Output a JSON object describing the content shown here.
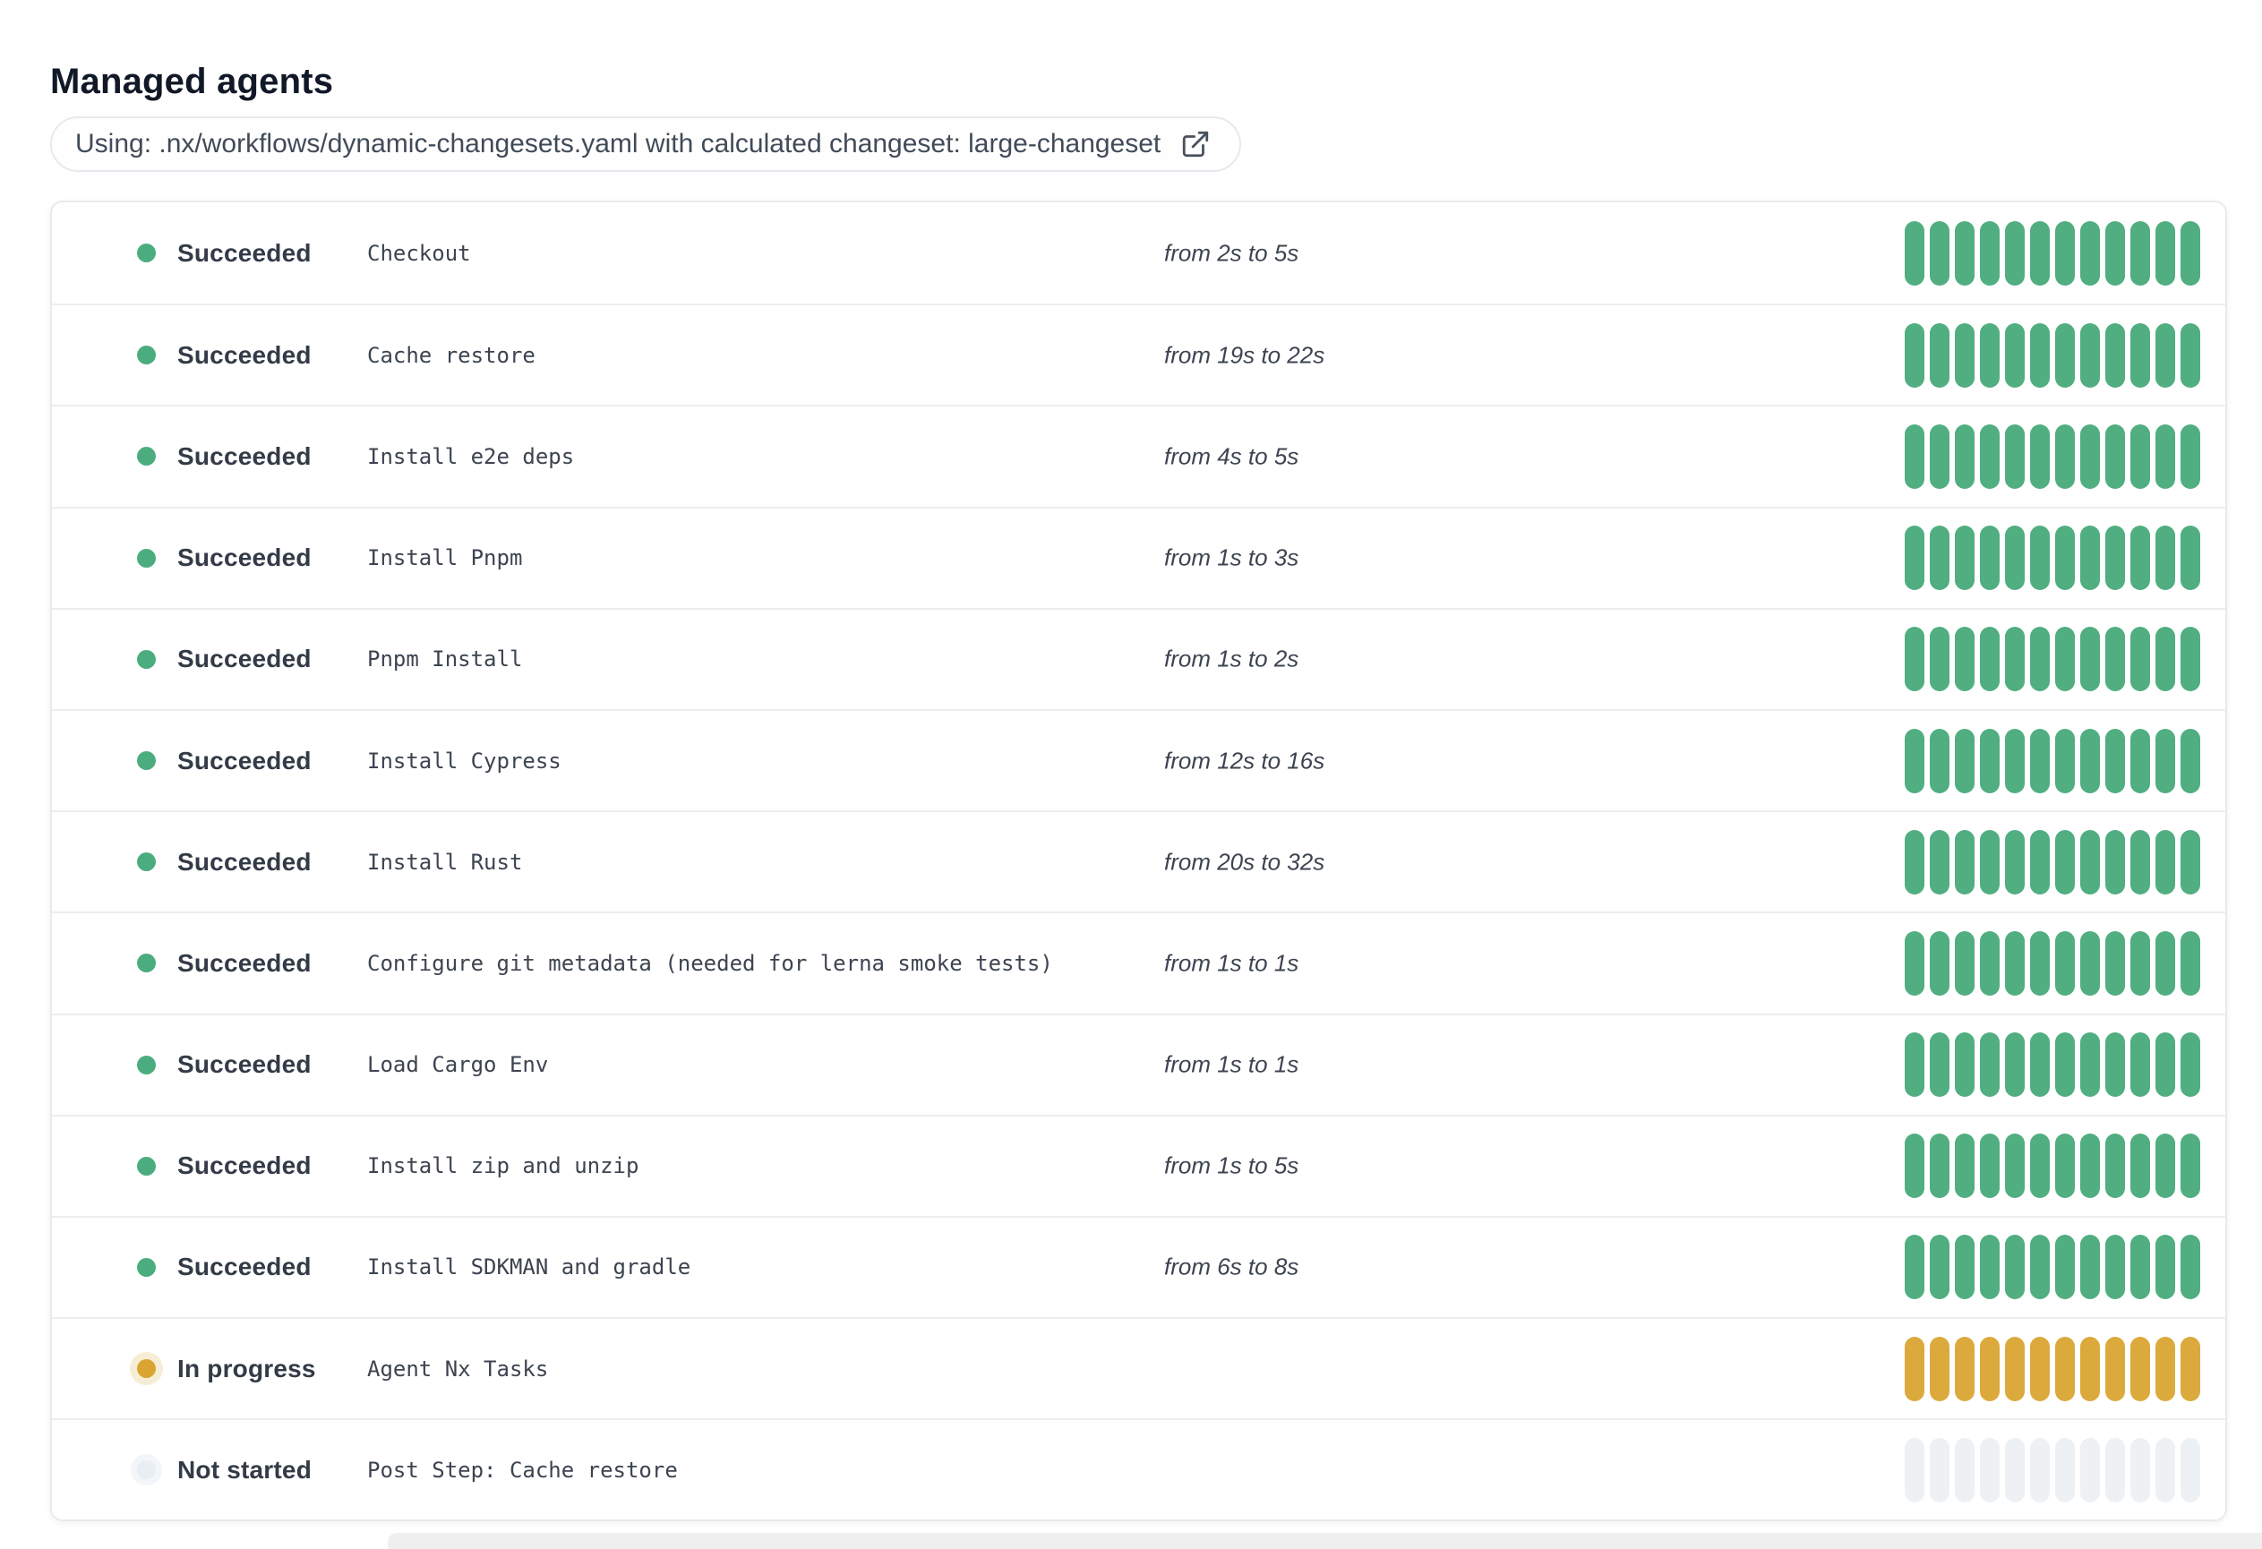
{
  "page": {
    "title": "Managed agents"
  },
  "workflow_banner": {
    "text": "Using: .nx/workflows/dynamic-changesets.yaml with calculated changeset: large-changeset",
    "icon": "external-link-icon"
  },
  "colors": {
    "succeeded_dot": "#4bad7f",
    "succeeded_seg": "#50ae81",
    "in_progress_dot": "#d9a431",
    "in_progress_halo": "#f6eed4",
    "in_progress_seg": "#dcaa3c",
    "not_started_dot": "#e9eef3",
    "not_started_halo": "#f2f5f9",
    "not_started_seg": "#edf1f4"
  },
  "agents": {
    "segments_per_row": 12,
    "rows": [
      {
        "status": "succeeded",
        "status_label": "Succeeded",
        "step": "Checkout",
        "duration": "from 2s to 5s"
      },
      {
        "status": "succeeded",
        "status_label": "Succeeded",
        "step": "Cache restore",
        "duration": "from 19s to 22s"
      },
      {
        "status": "succeeded",
        "status_label": "Succeeded",
        "step": "Install e2e deps",
        "duration": "from 4s to 5s"
      },
      {
        "status": "succeeded",
        "status_label": "Succeeded",
        "step": "Install Pnpm",
        "duration": "from 1s to 3s"
      },
      {
        "status": "succeeded",
        "status_label": "Succeeded",
        "step": "Pnpm Install",
        "duration": "from 1s to 2s"
      },
      {
        "status": "succeeded",
        "status_label": "Succeeded",
        "step": "Install Cypress",
        "duration": "from 12s to 16s"
      },
      {
        "status": "succeeded",
        "status_label": "Succeeded",
        "step": "Install Rust",
        "duration": "from 20s to 32s"
      },
      {
        "status": "succeeded",
        "status_label": "Succeeded",
        "step": "Configure git metadata (needed for lerna smoke tests)",
        "duration": "from 1s to 1s"
      },
      {
        "status": "succeeded",
        "status_label": "Succeeded",
        "step": "Load Cargo Env",
        "duration": "from 1s to 1s"
      },
      {
        "status": "succeeded",
        "status_label": "Succeeded",
        "step": "Install zip and unzip",
        "duration": "from 1s to 5s"
      },
      {
        "status": "succeeded",
        "status_label": "Succeeded",
        "step": "Install SDKMAN and gradle",
        "duration": "from 6s to 8s"
      },
      {
        "status": "in_progress",
        "status_label": "In progress",
        "step": "Agent Nx Tasks",
        "duration": ""
      },
      {
        "status": "not_started",
        "status_label": "Not started",
        "step": "Post Step: Cache restore",
        "duration": ""
      }
    ]
  }
}
